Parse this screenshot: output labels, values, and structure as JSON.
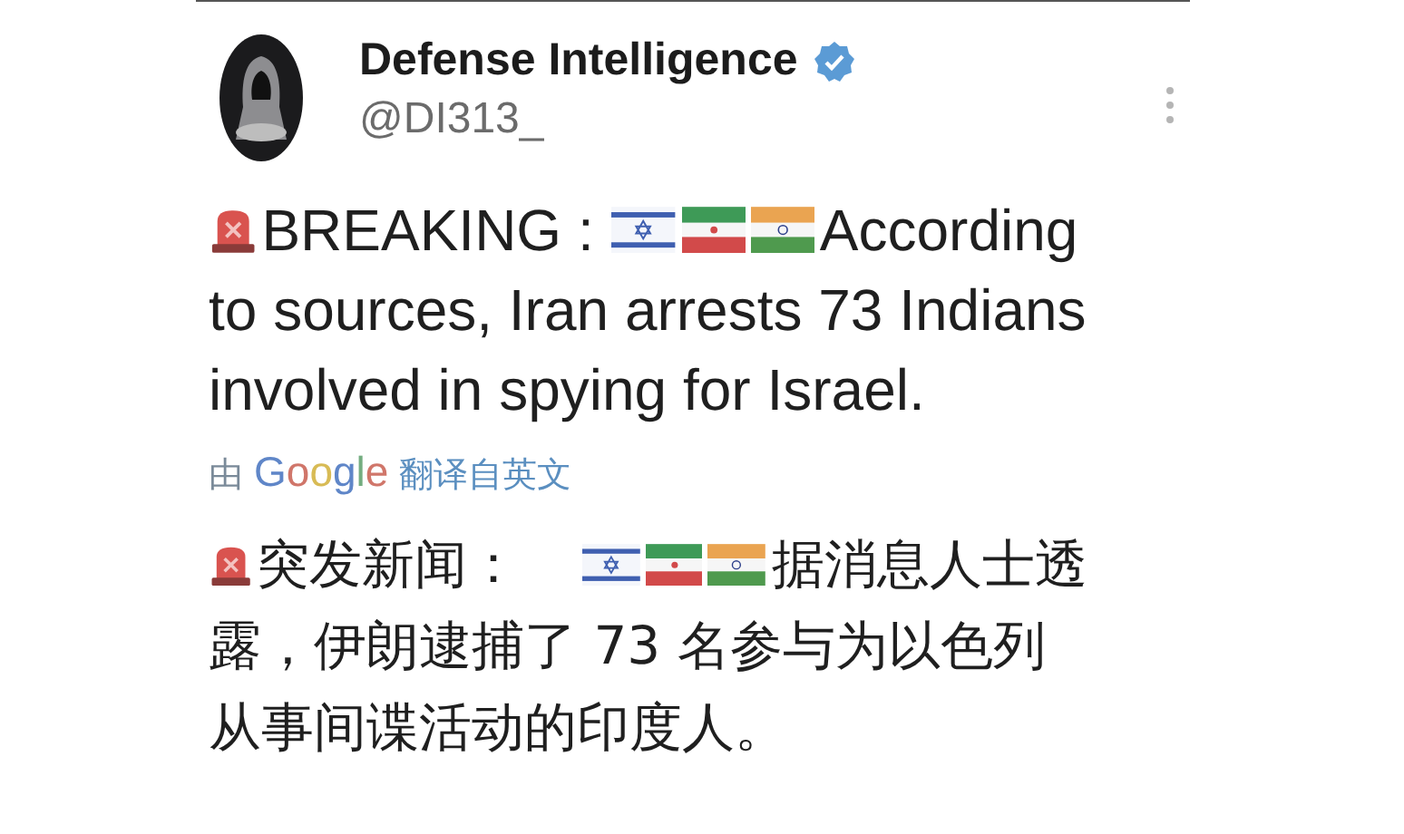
{
  "author": {
    "name": "Defense Intelligence",
    "verified": true,
    "handle": "@DI313_"
  },
  "post": [
    [
      {
        "kind": "siren"
      },
      {
        "kind": "text",
        "text": "BREAKING :"
      },
      {
        "kind": "flag_israel"
      },
      {
        "kind": "flag_iran"
      },
      {
        "kind": "flag_india"
      },
      {
        "kind": "text",
        "text": "According"
      }
    ],
    [
      {
        "kind": "text",
        "text": "to sources, Iran arrests 73 Indians"
      }
    ],
    [
      {
        "kind": "text",
        "text": "involved in spying for Israel."
      }
    ]
  ],
  "translation": {
    "prefix": "由",
    "provider": "Google",
    "suffix": "翻译自英文"
  },
  "translated_post": [
    [
      {
        "kind": "siren"
      },
      {
        "kind": "text",
        "text": "突发新闻："
      },
      {
        "kind": "flag_israel"
      },
      {
        "kind": "flag_iran"
      },
      {
        "kind": "flag_india"
      },
      {
        "kind": "text",
        "text": "据消息人士透"
      }
    ],
    [
      {
        "kind": "text",
        "text": "露，伊朗逮捕了 73 名参与为以色列"
      }
    ],
    [
      {
        "kind": "text",
        "text": "从事间谍活动的印度人。"
      }
    ]
  ]
}
